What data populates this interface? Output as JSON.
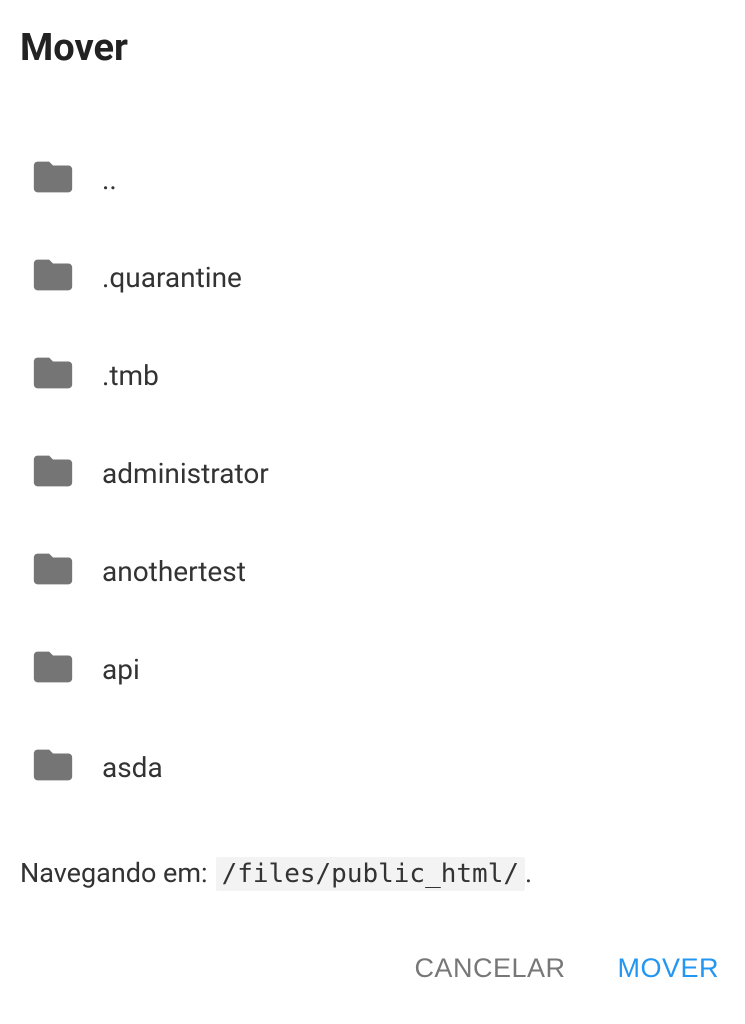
{
  "dialog": {
    "title": "Mover"
  },
  "folders": [
    {
      "name": ".."
    },
    {
      "name": ".quarantine"
    },
    {
      "name": ".tmb"
    },
    {
      "name": "administrator"
    },
    {
      "name": "anothertest"
    },
    {
      "name": "api"
    },
    {
      "name": "asda"
    }
  ],
  "breadcrumb": {
    "label": "Navegando em:",
    "path": "/files/public_html/",
    "suffix": "."
  },
  "actions": {
    "cancel": "CANCELAR",
    "move": "MOVER"
  }
}
